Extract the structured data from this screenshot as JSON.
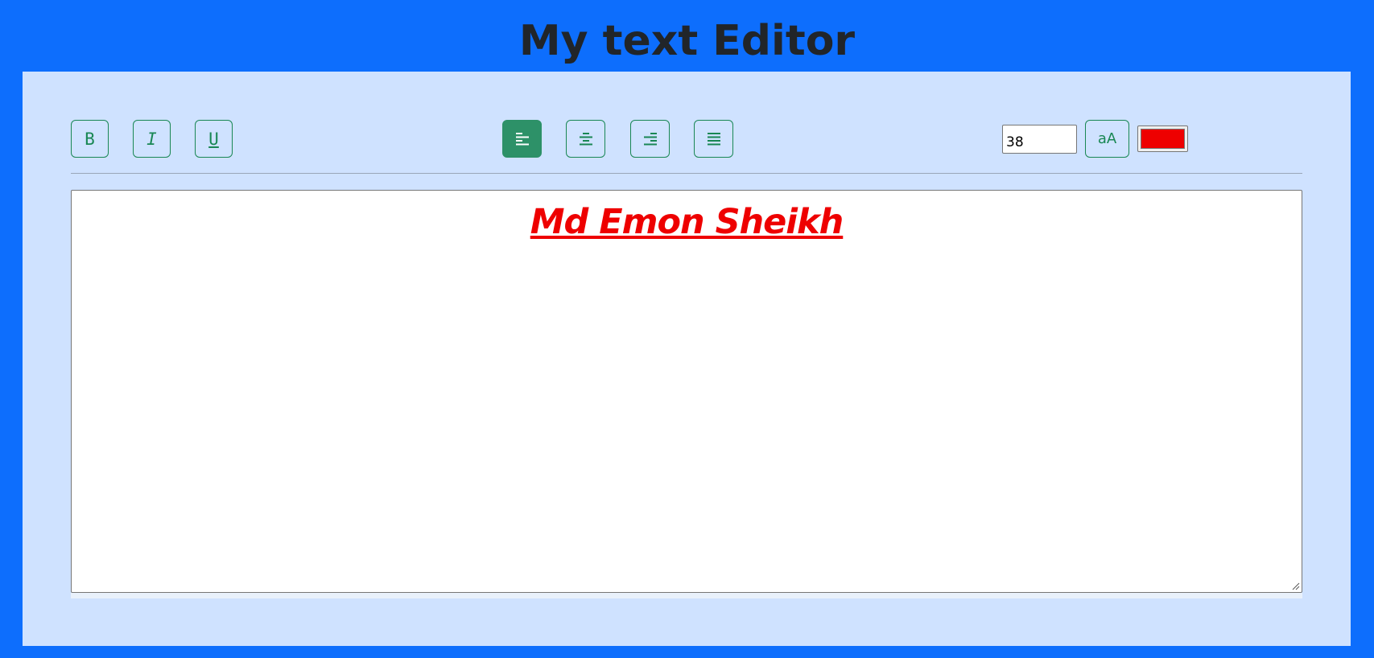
{
  "header": {
    "title": "My text Editor"
  },
  "toolbar": {
    "format_buttons": [
      {
        "name": "bold",
        "icon": "bold-icon",
        "label": "B"
      },
      {
        "name": "italic",
        "icon": "italic-icon",
        "label": "I"
      },
      {
        "name": "underline",
        "icon": "underline-icon",
        "label": "U"
      }
    ],
    "align_buttons": [
      {
        "name": "align-left",
        "icon": "align-left-icon",
        "active": true
      },
      {
        "name": "align-center",
        "icon": "align-center-icon",
        "active": false
      },
      {
        "name": "align-right",
        "icon": "align-right-icon",
        "active": false
      },
      {
        "name": "align-justify",
        "icon": "align-justify-icon",
        "active": false
      }
    ],
    "font_size_value": "38",
    "case_label": "aA",
    "text_color": "#ee0000"
  },
  "editor": {
    "content": "Md Emon Sheikh"
  },
  "colors": {
    "background": "#0d6efd",
    "panel": "#cfe2ff",
    "accent": "#198754",
    "active_button": "#2d9168"
  }
}
